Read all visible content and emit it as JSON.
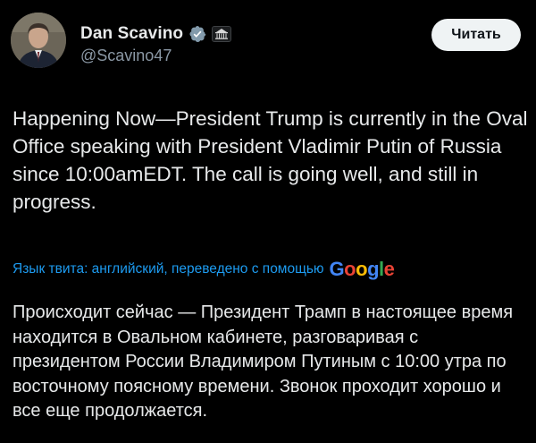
{
  "user": {
    "display_name": "Dan Scavino",
    "handle": "@Scavino47"
  },
  "follow_button": {
    "label": "Читать"
  },
  "tweet": {
    "text": "Happening Now—President Trump is currently in the Oval Office speaking with President Vladimir Putin of Russia since 10:00amEDT. The call is going well, and still in progress."
  },
  "translation": {
    "label": "Язык твита: английский, переведено с помощью",
    "provider_logo": "Google",
    "text": "Происходит сейчас — Президент Трамп в настоящее время находится в Овальном кабинете, разговаривая с президентом России Владимиром Путиным с 10:00 утра по восточному поясному времени. Звонок проходит хорошо и все еще продолжается."
  },
  "icons": {
    "verified": "verified-badge-icon",
    "affiliate": "white-house-affiliate-icon"
  },
  "colors": {
    "background": "#000000",
    "text": "#e7e9ea",
    "secondary_text": "#8b98a5",
    "link": "#1d9bf0",
    "verified_badge": "#829aab",
    "button_bg": "#eff3f4",
    "button_text": "#0f1419"
  }
}
